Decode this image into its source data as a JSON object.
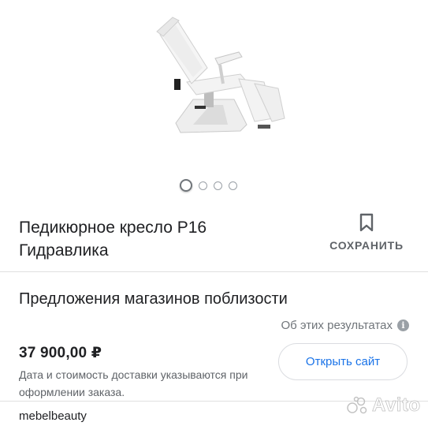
{
  "product": {
    "title_line1": "Педикюрное кресло P16",
    "title_line2": "Гидравлика",
    "image_icon": "pedicure-chair-image",
    "carousel": {
      "total": 4,
      "active": 1
    }
  },
  "save": {
    "label": "СОХРАНИТЬ",
    "icon": "bookmark-icon"
  },
  "offers": {
    "heading": "Предложения магазинов поблизости",
    "about_label": "Об этих результатах",
    "about_icon": "info-icon"
  },
  "listing": {
    "price": "37 900,00 ₽",
    "delivery_note": "Дата и стоимость доставки указываются при оформлении заказа.",
    "open_button": "Открыть сайт",
    "store_name": "mebelbeauty"
  },
  "watermark": {
    "brand": "Avito"
  },
  "colors": {
    "link_blue": "#1a73e8",
    "muted": "#70757a",
    "divider": "#e0e0e0"
  }
}
